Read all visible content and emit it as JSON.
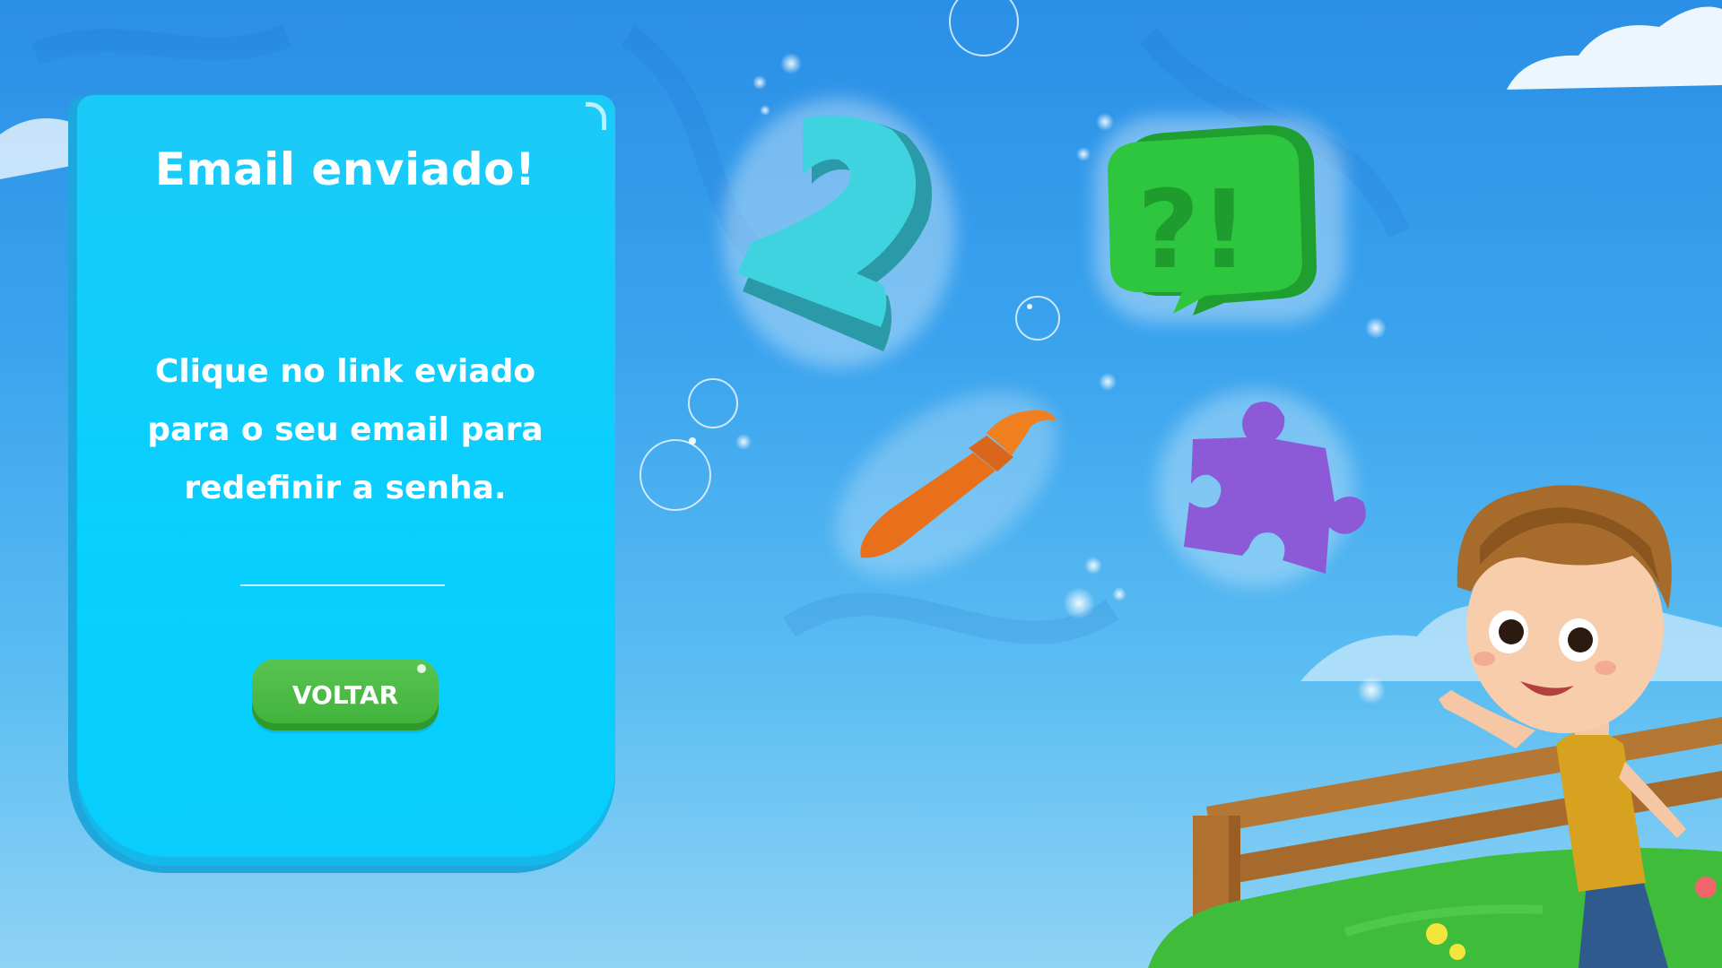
{
  "card": {
    "title": "Email enviado!",
    "message": "Clique no link eviado para o seu email para redefinir a senha.",
    "back_button_label": "VOLTAR"
  },
  "illustration": {
    "number_glyph": "2",
    "speech_bubble_glyph": "?!",
    "icons": [
      "number-two-icon",
      "speech-bubble-icon",
      "paintbrush-icon",
      "puzzle-piece-icon",
      "boy-character",
      "wooden-fence",
      "grass-hill",
      "cloud",
      "bubble"
    ]
  },
  "colors": {
    "sky_top": "#2a8fe6",
    "card": "#07d0ff",
    "button": "#3fb23a",
    "number": "#3fd0dc",
    "bubble_green": "#2cc43c",
    "brush": "#f07f1f",
    "puzzle": "#8c5ad6"
  }
}
